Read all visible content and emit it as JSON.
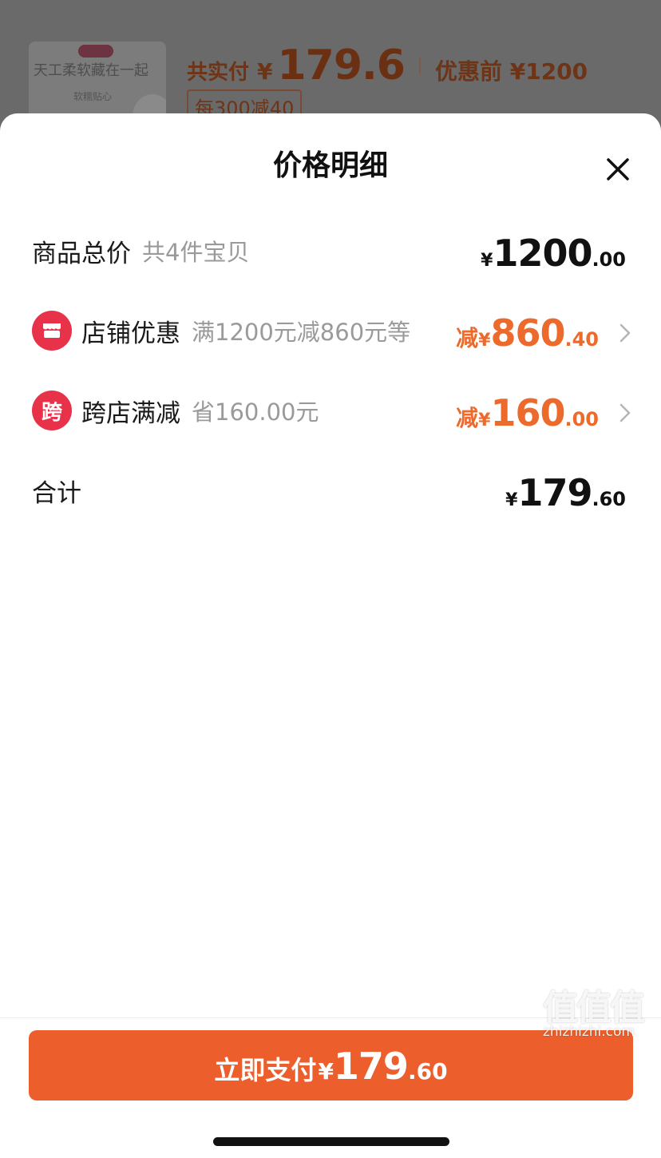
{
  "background": {
    "thumbnail_text": "天工柔软藏在一起",
    "thumbnail_sub": "软糯贴心",
    "paid_label": "共实付",
    "paid_yen": "¥",
    "paid_amount": "179.6",
    "before_label": "优惠前 ¥1200",
    "promo_tag": "每300减40"
  },
  "sheet": {
    "title": "价格明细",
    "close_icon": "close-icon",
    "rows": {
      "total": {
        "label": "商品总价",
        "sub": "共4件宝贝",
        "yen": "¥",
        "int": "1200",
        "dec": ".00"
      },
      "shop_discount": {
        "icon": "shop-icon",
        "label": "店铺优惠",
        "sub": "满1200元减860元等",
        "prefix": "减",
        "yen": "¥",
        "int": "860",
        "dec": ".40"
      },
      "cross_store": {
        "icon_char": "跨",
        "label": "跨店满减",
        "sub": "省160.00元",
        "prefix": "减",
        "yen": "¥",
        "int": "160",
        "dec": ".00"
      },
      "sum": {
        "label": "合计",
        "yen": "¥",
        "int": "179",
        "dec": ".60"
      }
    }
  },
  "footer": {
    "pay_label": "立即支付",
    "pay_yen": "¥",
    "pay_int": "179",
    "pay_dec": ".60"
  },
  "watermark": {
    "logo": "值值值",
    "url": "zhizhizhi.com"
  },
  "colors": {
    "accent_orange": "#ec6a2b",
    "pay_button": "#ec5f2c",
    "badge_red": "#e8324a"
  }
}
